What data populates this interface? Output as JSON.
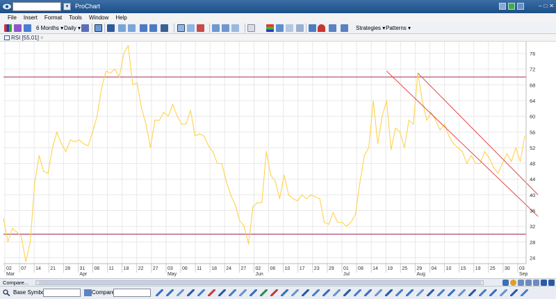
{
  "window": {
    "app_title": "ProChart",
    "symbol_value": "",
    "controls": [
      "–",
      "□",
      "✕"
    ]
  },
  "menu": [
    "File",
    "Insert",
    "Format",
    "Tools",
    "Window",
    "Help"
  ],
  "toolbar": {
    "period_label": "6 Months",
    "interval_label": "Daily",
    "strategies_label": "Strategies",
    "patterns_label": "Patterns"
  },
  "study_tab": {
    "label": "RSI [55.01]",
    "close": "×"
  },
  "colors": {
    "rsi_line": "#ffd24d",
    "threshold_lines": "#a0245a",
    "trend_channel": "#e0494a",
    "grid": "#e8e8e8"
  },
  "chart_data": {
    "type": "line",
    "title": "",
    "series": [
      {
        "name": "RSI",
        "values": [
          34.0,
          28.0,
          31.5,
          30.5,
          29.5,
          23.0,
          28.0,
          43.0,
          50.0,
          46.0,
          45.5,
          52.0,
          56.0,
          53.0,
          51.0,
          54.0,
          53.5,
          54.0,
          53.0,
          52.5,
          56.0,
          60.0,
          67.0,
          71.5,
          71.0,
          72.0,
          70.0,
          76.0,
          78.0,
          68.0,
          68.5,
          62.0,
          58.0,
          52.0,
          59.0,
          59.0,
          61.0,
          60.0,
          63.0,
          60.0,
          58.0,
          58.0,
          61.5,
          55.0,
          55.5,
          55.0,
          52.5,
          51.0,
          48.0,
          48.0,
          43.5,
          40.0,
          37.5,
          33.5,
          32.0,
          27.5,
          37.0,
          38.0,
          38.0,
          51.0,
          45.0,
          43.5,
          39.0,
          45.0,
          40.0,
          39.0,
          38.5,
          40.0,
          39.0,
          40.0,
          39.5,
          39.0,
          33.0,
          32.5,
          35.5,
          33.0,
          33.0,
          32.0,
          33.0,
          35.0,
          43.0,
          50.0,
          52.0,
          64.0,
          53.0,
          60.0,
          64.0,
          51.5,
          57.0,
          56.0,
          52.0,
          59.0,
          58.0,
          71.0,
          64.0,
          59.0,
          61.0,
          59.0,
          56.5,
          58.0,
          55.0,
          53.0,
          52.0,
          51.0,
          48.0,
          50.0,
          48.0,
          48.0,
          51.0,
          49.5,
          47.0,
          45.5,
          48.0,
          50.5,
          48.5,
          52.0,
          48.5,
          55.0
        ]
      }
    ],
    "x_ticks": [
      "02",
      "07",
      "14",
      "21",
      "28",
      "31",
      "06",
      "11",
      "18",
      "22",
      "27",
      "03",
      "06",
      "11",
      "18",
      "24",
      "27",
      "02",
      "06",
      "10",
      "17",
      "23",
      "29",
      "01",
      "08",
      "14",
      "19",
      "25",
      "29",
      "04",
      "10",
      "15",
      "19",
      "25",
      "30",
      "03"
    ],
    "x_month_labels": [
      {
        "tick_index": 0,
        "label": "Mar"
      },
      {
        "tick_index": 5,
        "label": "Apr"
      },
      {
        "tick_index": 11,
        "label": "May"
      },
      {
        "tick_index": 17,
        "label": "Jun"
      },
      {
        "tick_index": 23,
        "label": "Jul"
      },
      {
        "tick_index": 28,
        "label": "Aug"
      },
      {
        "tick_index": 35,
        "label": "Sep"
      }
    ],
    "y_ticks": [
      24,
      28,
      32,
      36,
      40,
      44,
      48,
      52,
      56,
      60,
      64,
      68,
      72,
      76
    ],
    "ylim": [
      22.5,
      79.0
    ],
    "threshold_lines": [
      70,
      30
    ],
    "trend_lines": [
      {
        "from": {
          "index": 86,
          "value": 71.5
        },
        "to": {
          "index": 120,
          "value": 34.5
        }
      },
      {
        "from": {
          "index": 93,
          "value": 71.0
        },
        "to": {
          "index": 120,
          "value": 40.0
        }
      }
    ],
    "grid": true
  },
  "bottom": {
    "compare_label": "Compare...",
    "base_symbol_label": "Base Symbol",
    "compare_field_label": "Compare"
  }
}
